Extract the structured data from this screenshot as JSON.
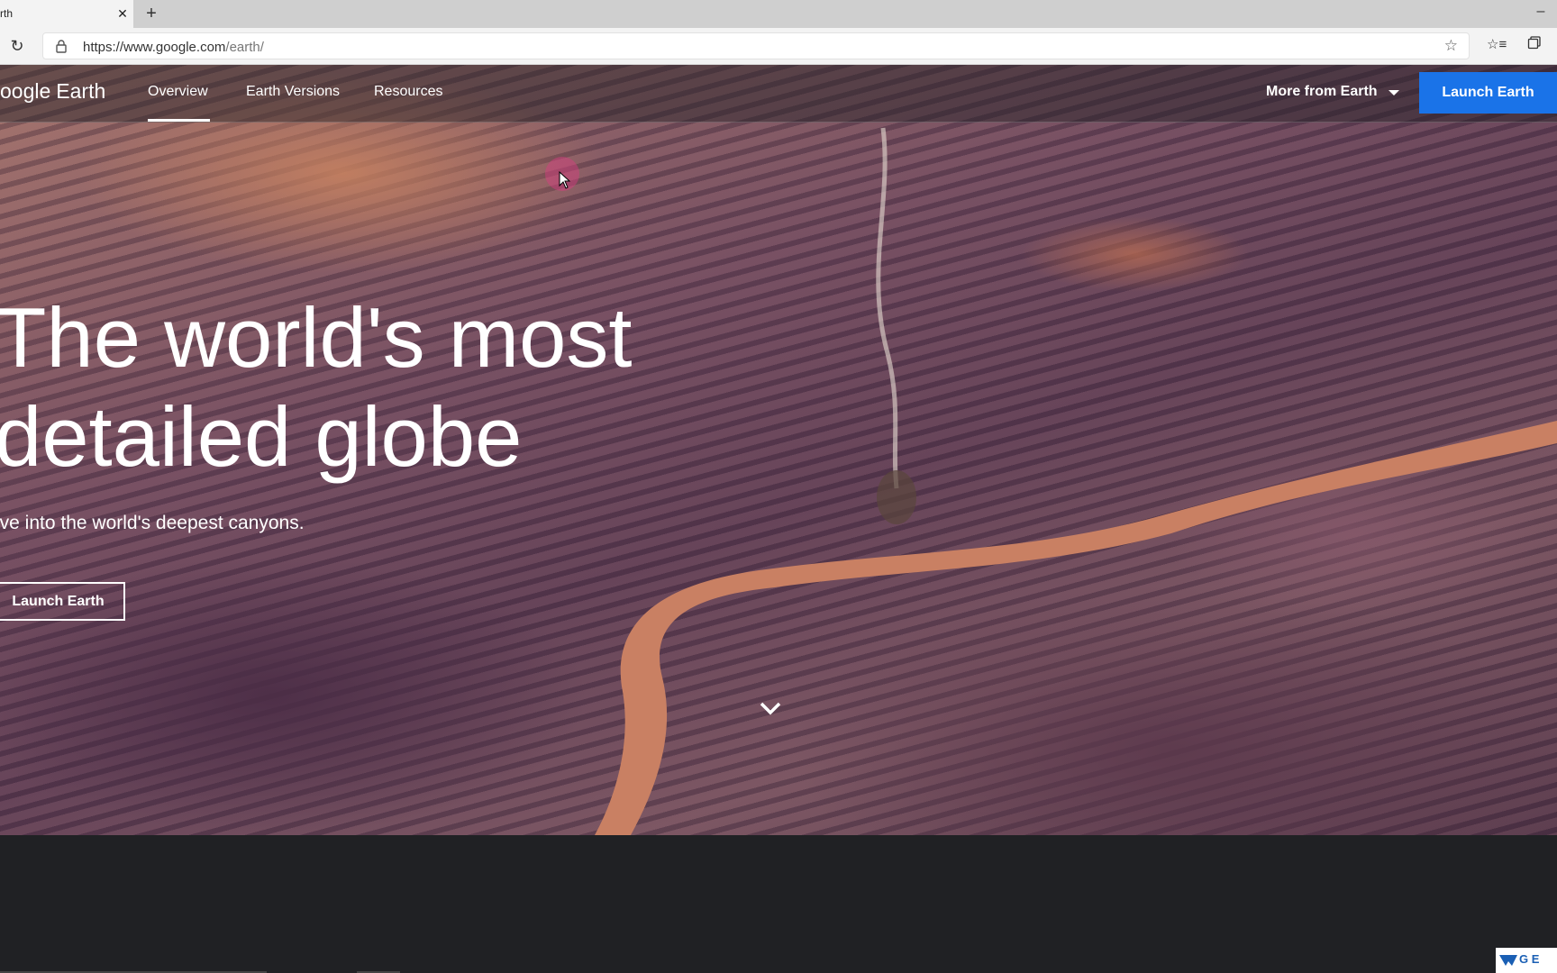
{
  "browser": {
    "tab_title": "rth",
    "tab_close": "✕",
    "new_tab": "+",
    "minimize": "–",
    "reload": "↻",
    "url_host": "https://www.google.com",
    "url_path": "/earth/",
    "star": "☆",
    "favorites": "☆≡"
  },
  "nav": {
    "logo_google": "oogle",
    "logo_product": "Earth",
    "links": [
      {
        "label": "Overview",
        "active": true
      },
      {
        "label": "Earth Versions"
      },
      {
        "label": "Resources"
      }
    ],
    "more": "More from Earth",
    "launch": "Launch Earth"
  },
  "hero": {
    "headline_line1": "The world's most",
    "headline_line2": "detailed globe",
    "subtext": "ive into the world's deepest canyons.",
    "cta": "Launch Earth"
  },
  "badge": {
    "text": "G E"
  },
  "colors": {
    "accent": "#1a73e8",
    "footer_bg": "#202124",
    "river": "#c98063"
  }
}
